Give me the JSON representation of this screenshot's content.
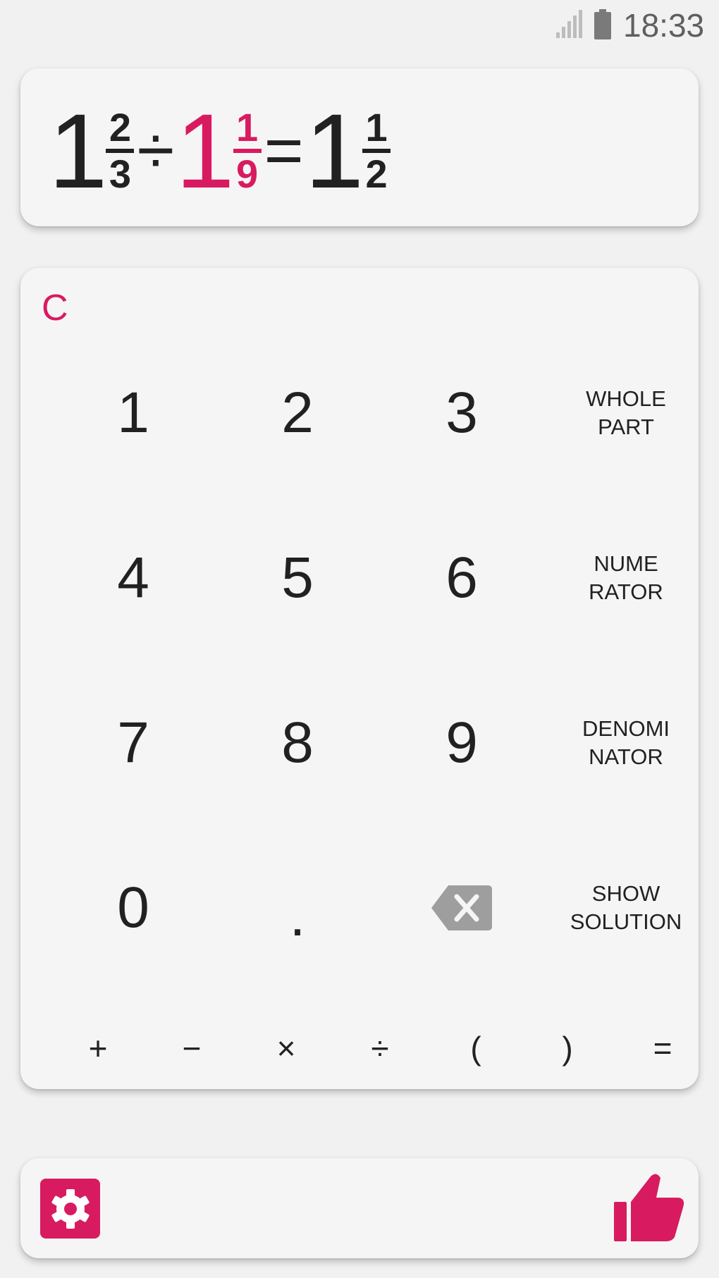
{
  "status_bar": {
    "time": "18:33",
    "icons": [
      "signal-icon",
      "battery-icon"
    ]
  },
  "expression": {
    "term1": {
      "whole": "1",
      "numerator": "2",
      "denominator": "3"
    },
    "operator": "÷",
    "term2": {
      "whole": "1",
      "numerator": "1",
      "denominator": "9"
    },
    "equals": "=",
    "result": {
      "whole": "1",
      "numerator": "1",
      "denominator": "2"
    }
  },
  "keypad": {
    "clear": "C",
    "digits": {
      "d1": "1",
      "d2": "2",
      "d3": "3",
      "d4": "4",
      "d5": "5",
      "d6": "6",
      "d7": "7",
      "d8": "8",
      "d9": "9",
      "d0": "0",
      "dot": "."
    },
    "whole_part": [
      "WHOLE",
      "PART"
    ],
    "numerator": [
      "NUME",
      "RATOR"
    ],
    "denominator": [
      "DENOMI",
      "NATOR"
    ],
    "show_solution": [
      "SHOW",
      "SOLUTION"
    ],
    "backspace_icon": "backspace-icon",
    "operators": {
      "plus": "+",
      "minus": "−",
      "times": "×",
      "divide": "÷",
      "open_paren": "(",
      "close_paren": ")",
      "equals": "="
    }
  },
  "bottom_bar": {
    "settings_icon": "gear-icon",
    "like_icon": "thumbs-up-icon"
  },
  "colors": {
    "accent": "#d81b60",
    "text": "#212121",
    "card": "#f5f5f5",
    "background": "#f1f1f1",
    "backspace": "#9e9e9e"
  }
}
